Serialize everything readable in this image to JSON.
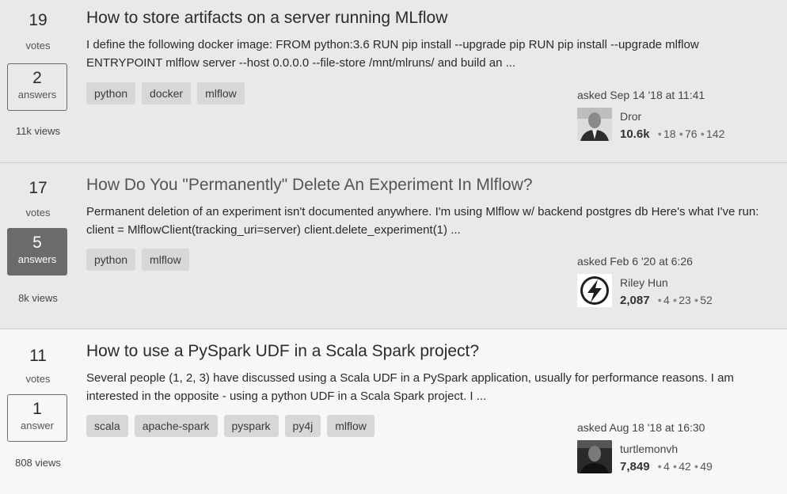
{
  "questions": [
    {
      "votes": "19",
      "votes_label": "votes",
      "answers": "2",
      "answers_label": "answers",
      "views": "11k views",
      "title": "How to store artifacts on a server running MLflow",
      "excerpt": "I define the following docker image: FROM python:3.6 RUN pip install --upgrade pip RUN pip install --upgrade mlflow ENTRYPOINT mlflow server --host 0.0.0.0 --file-store /mnt/mlruns/ and build an ...",
      "tags": [
        "python",
        "docker",
        "mlflow"
      ],
      "asked": "asked Sep 14 '18 at 11:41",
      "user": "Dror",
      "rep": "10.6k",
      "gold": "18",
      "silver": "76",
      "bronze": "142",
      "avatar": "portrait-photo"
    },
    {
      "votes": "17",
      "votes_label": "votes",
      "answers": "5",
      "answers_label": "answers",
      "views": "8k views",
      "title": "How Do You \"Permanently\" Delete An Experiment In Mlflow?",
      "excerpt": "Permanent deletion of an experiment isn't documented anywhere. I'm using Mlflow w/ backend postgres db Here's what I've run: client = MlflowClient(tracking_uri=server) client.delete_experiment(1) ...",
      "tags": [
        "python",
        "mlflow"
      ],
      "asked": "asked Feb 6 '20 at 6:26",
      "user": "Riley Hun",
      "rep": "2,087",
      "gold": "4",
      "silver": "23",
      "bronze": "52",
      "avatar": "lightning-bolt-icon"
    },
    {
      "votes": "11",
      "votes_label": "votes",
      "answers": "1",
      "answers_label": "answer",
      "views": "808 views",
      "title": "How to use a PySpark UDF in a Scala Spark project?",
      "excerpt": "Several people (1, 2, 3) have discussed using a Scala UDF in a PySpark application, usually for performance reasons. I am interested in the opposite - using a python UDF in a Scala Spark project. I ...",
      "tags": [
        "scala",
        "apache-spark",
        "pyspark",
        "py4j",
        "mlflow"
      ],
      "asked": "asked Aug 18 '18 at 16:30",
      "user": "turtlemonvh",
      "rep": "7,849",
      "gold": "4",
      "silver": "42",
      "bronze": "49",
      "avatar": "portrait-photo"
    }
  ],
  "colors": {
    "shaded_bg": "#e9e9e9",
    "plain_bg": "#f7f7f7",
    "accepted": "#6b6b6b",
    "tag_bg": "#d7d7d7"
  }
}
